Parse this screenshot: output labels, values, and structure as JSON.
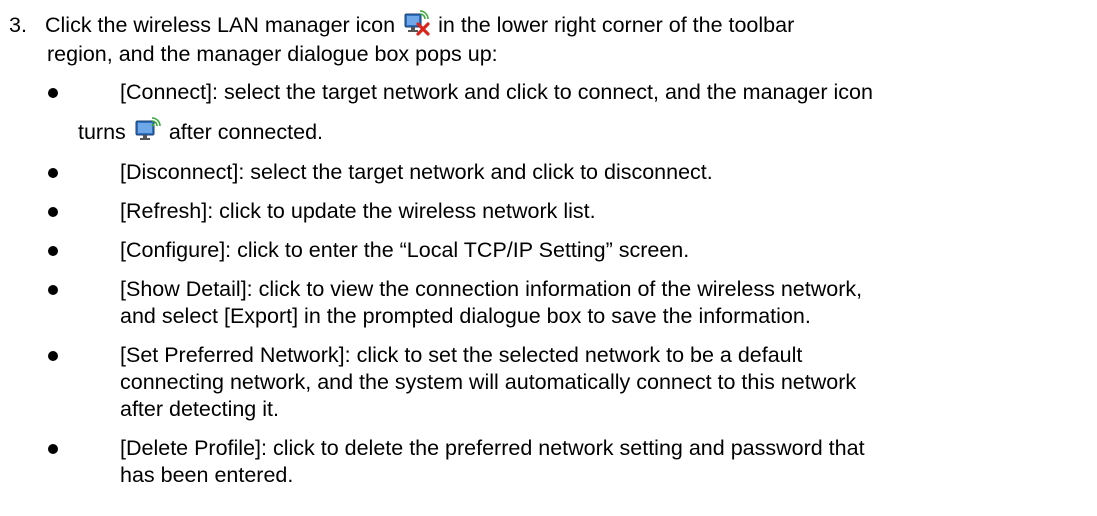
{
  "step": {
    "number": "3.",
    "text_before_icon": "Click the wireless LAN manager icon",
    "icon_disconnected": "wifi-manager-disconnected-icon",
    "text_after_icon": "in the lower right corner of the toolbar",
    "line2": "region, and the manager dialogue box pops up:"
  },
  "bullets": [
    {
      "label": "[Connect]",
      "text": ": select the target network and click to connect, and the manager icon",
      "cont_before_icon": "turns",
      "icon_connected": "wifi-manager-connected-icon",
      "cont_after_icon": "after connected."
    },
    {
      "label": "[Disconnect]",
      "text": ": select the target network and click to disconnect."
    },
    {
      "label": "[Refresh]",
      "text": ": click to update the wireless network list."
    },
    {
      "label": "[Configure]",
      "text": ": click to enter the “Local TCP/IP Setting” screen."
    },
    {
      "label": "[Show Detail]",
      "text": ": click to view the connection information of the wireless network,",
      "line2": "and select [Export] in the prompted dialogue box to save the information."
    },
    {
      "label": "[Set Preferred Network]",
      "text": ": click to set the selected network to be a default",
      "line2": "connecting network, and the system will automatically connect to this network",
      "line3": "after detecting it."
    },
    {
      "label": "[Delete Profile]",
      "text": ": click to delete the preferred network setting and password that",
      "line2": "has been entered."
    }
  ],
  "colors": {
    "text": "#000000",
    "icon_monitor": "#2f6fc0",
    "icon_x": "#d9241c",
    "icon_signal": "#3aa83a"
  }
}
